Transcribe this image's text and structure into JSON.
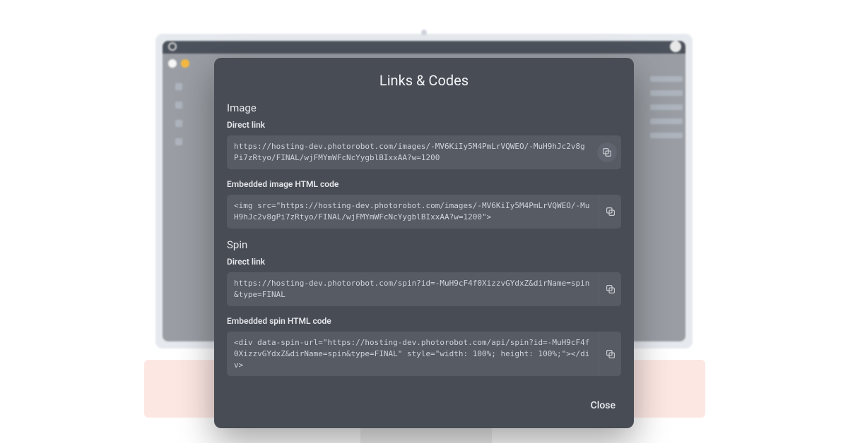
{
  "modal": {
    "title": "Links & Codes",
    "close_label": "Close",
    "sections": {
      "image": {
        "heading": "Image",
        "direct_label": "Direct link",
        "direct_value": "https://hosting-dev.photorobot.com/images/-MV6KiIy5M4PmLrVQWEO/-MuH9hJc2v8gPi7zRtyo/FINAL/wjFMYmWFcNcYygblBIxxAA?w=1200",
        "embed_label": "Embedded image HTML code",
        "embed_value": "<img src=\"https://hosting-dev.photorobot.com/images/-MV6KiIy5M4PmLrVQWEO/-MuH9hJc2v8gPi7zRtyo/FINAL/wjFMYmWFcNcYygblBIxxAA?w=1200\">"
      },
      "spin": {
        "heading": "Spin",
        "direct_label": "Direct link",
        "direct_value": "https://hosting-dev.photorobot.com/spin?id=-MuH9cF4f0XizzvGYdxZ&dirName=spin&type=FINAL",
        "embed_label": "Embedded spin HTML code",
        "embed_value": "<div data-spin-url=\"https://hosting-dev.photorobot.com/api/spin?id=-MuH9cF4f0XizzvGYdxZ&dirName=spin&type=FINAL\" style=\"width: 100%; height: 100%;\"></div>"
      }
    }
  }
}
